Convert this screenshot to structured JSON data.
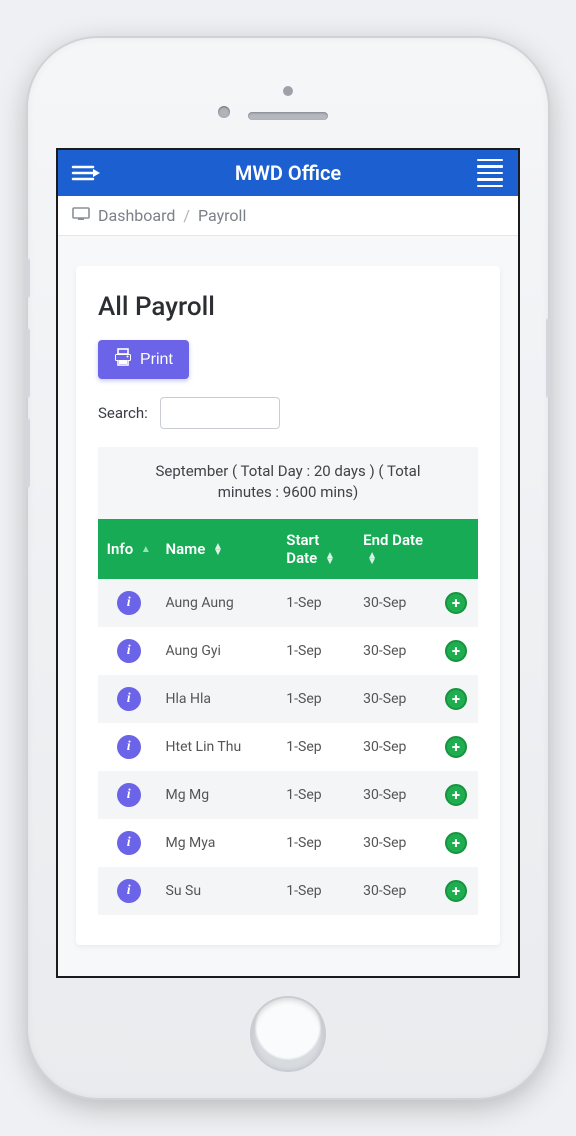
{
  "appbar": {
    "title": "MWD Office"
  },
  "breadcrumb": {
    "root": "Dashboard",
    "current": "Payroll"
  },
  "page": {
    "heading": "All Payroll",
    "print_label": "Print",
    "search_label": "Search:",
    "search_value": ""
  },
  "summary": "September ( Total Day : 20 days ) ( Total minutes : 9600 mins)",
  "columns": {
    "info": "Info",
    "name": "Name",
    "start": "Start Date",
    "end": "End Date"
  },
  "rows": [
    {
      "name": "Aung Aung",
      "start": "1-Sep",
      "end": "30-Sep"
    },
    {
      "name": "Aung Gyi",
      "start": "1-Sep",
      "end": "30-Sep"
    },
    {
      "name": "Hla Hla",
      "start": "1-Sep",
      "end": "30-Sep"
    },
    {
      "name": "Htet Lin Thu",
      "start": "1-Sep",
      "end": "30-Sep"
    },
    {
      "name": "Mg Mg",
      "start": "1-Sep",
      "end": "30-Sep"
    },
    {
      "name": "Mg Mya",
      "start": "1-Sep",
      "end": "30-Sep"
    },
    {
      "name": "Su Su",
      "start": "1-Sep",
      "end": "30-Sep"
    }
  ]
}
